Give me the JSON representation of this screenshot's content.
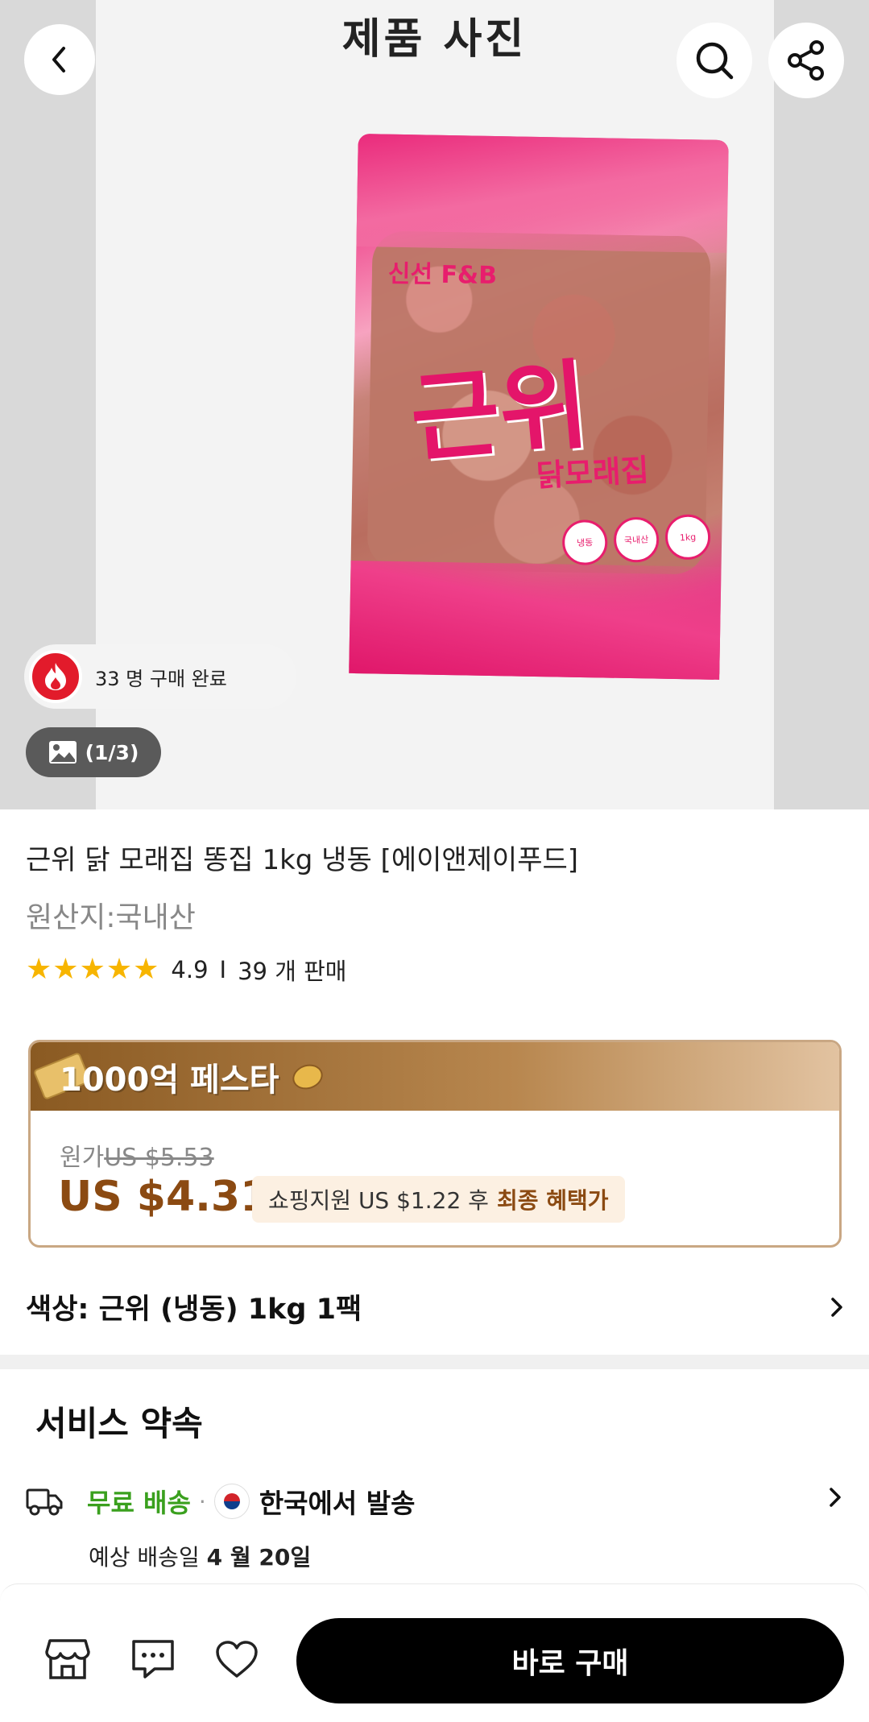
{
  "header": {
    "title": "제품 사진",
    "back_icon": "chevron-left-icon",
    "search_icon": "search-icon",
    "share_icon": "share-icon"
  },
  "hero": {
    "bag_brand": "신선 F&B",
    "bag_name": "근위",
    "bag_subtitle": "닭모래집",
    "bag_badge_1": "냉동",
    "bag_badge_2": "국내산",
    "bag_badge_3": "1kg",
    "sold_text": "33 명 구매 완료",
    "photo_counter": "(1/3)"
  },
  "product": {
    "title": "근위 닭 모래집 똥집 1kg 냉동 [에이앤제이푸드]",
    "origin": "원산지:국내산",
    "rating": "4.9",
    "rating_stars": 5,
    "separator": "I",
    "sold_count": "39 개 판매"
  },
  "price": {
    "festival_label": "1000억 페스타",
    "original_label": "원가",
    "original_price": "US $5.53",
    "final_price": "US $4.31",
    "benefit_prefix": "쇼핑지원 US $1.22 후",
    "benefit_strong": "최종 혜택가"
  },
  "option": {
    "label": "색상: 근위 (냉동) 1kg 1팩"
  },
  "service": {
    "title": "서비스 약속",
    "free_shipping": "무료 배송",
    "dot": "·",
    "ship_from": "한국에서 발송",
    "eta_prefix": "예상 배송일",
    "eta_date": "4 월 20일"
  },
  "bottom_bar": {
    "buy_label": "바로 구매"
  },
  "colors": {
    "price_brown": "#8b4a12",
    "free_ship_green": "#3aa01e",
    "star_yellow": "#f7b500",
    "buy_button": "#000000"
  }
}
